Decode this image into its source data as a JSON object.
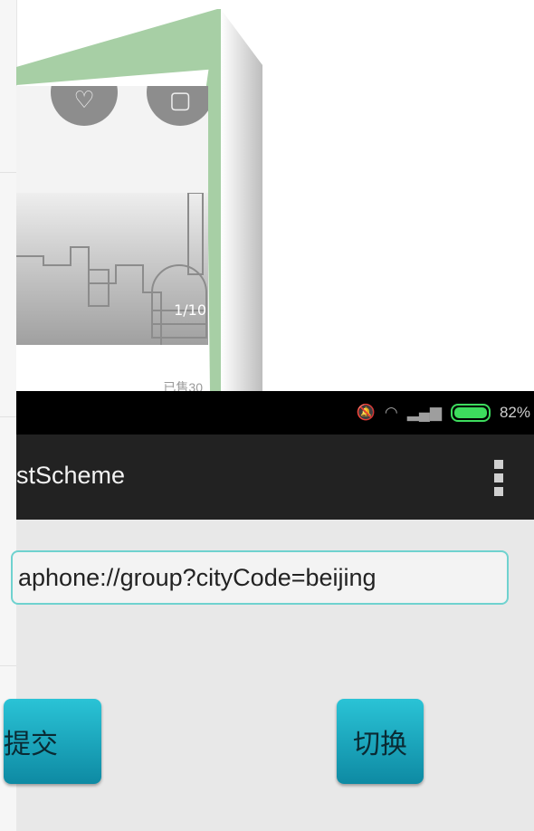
{
  "card": {
    "image_counter": "1/10",
    "footer_text": "已售30"
  },
  "status_bar": {
    "battery_percent": "82%"
  },
  "app": {
    "title": "stScheme"
  },
  "scheme_input": {
    "value": "aphone://group?cityCode=beijing"
  },
  "buttons": {
    "submit": "提交",
    "switch": "切换"
  },
  "colors": {
    "flip_green": "#a7cfa5",
    "accent_teal": "#1aa9c0",
    "battery_green": "#3ddc5d"
  }
}
